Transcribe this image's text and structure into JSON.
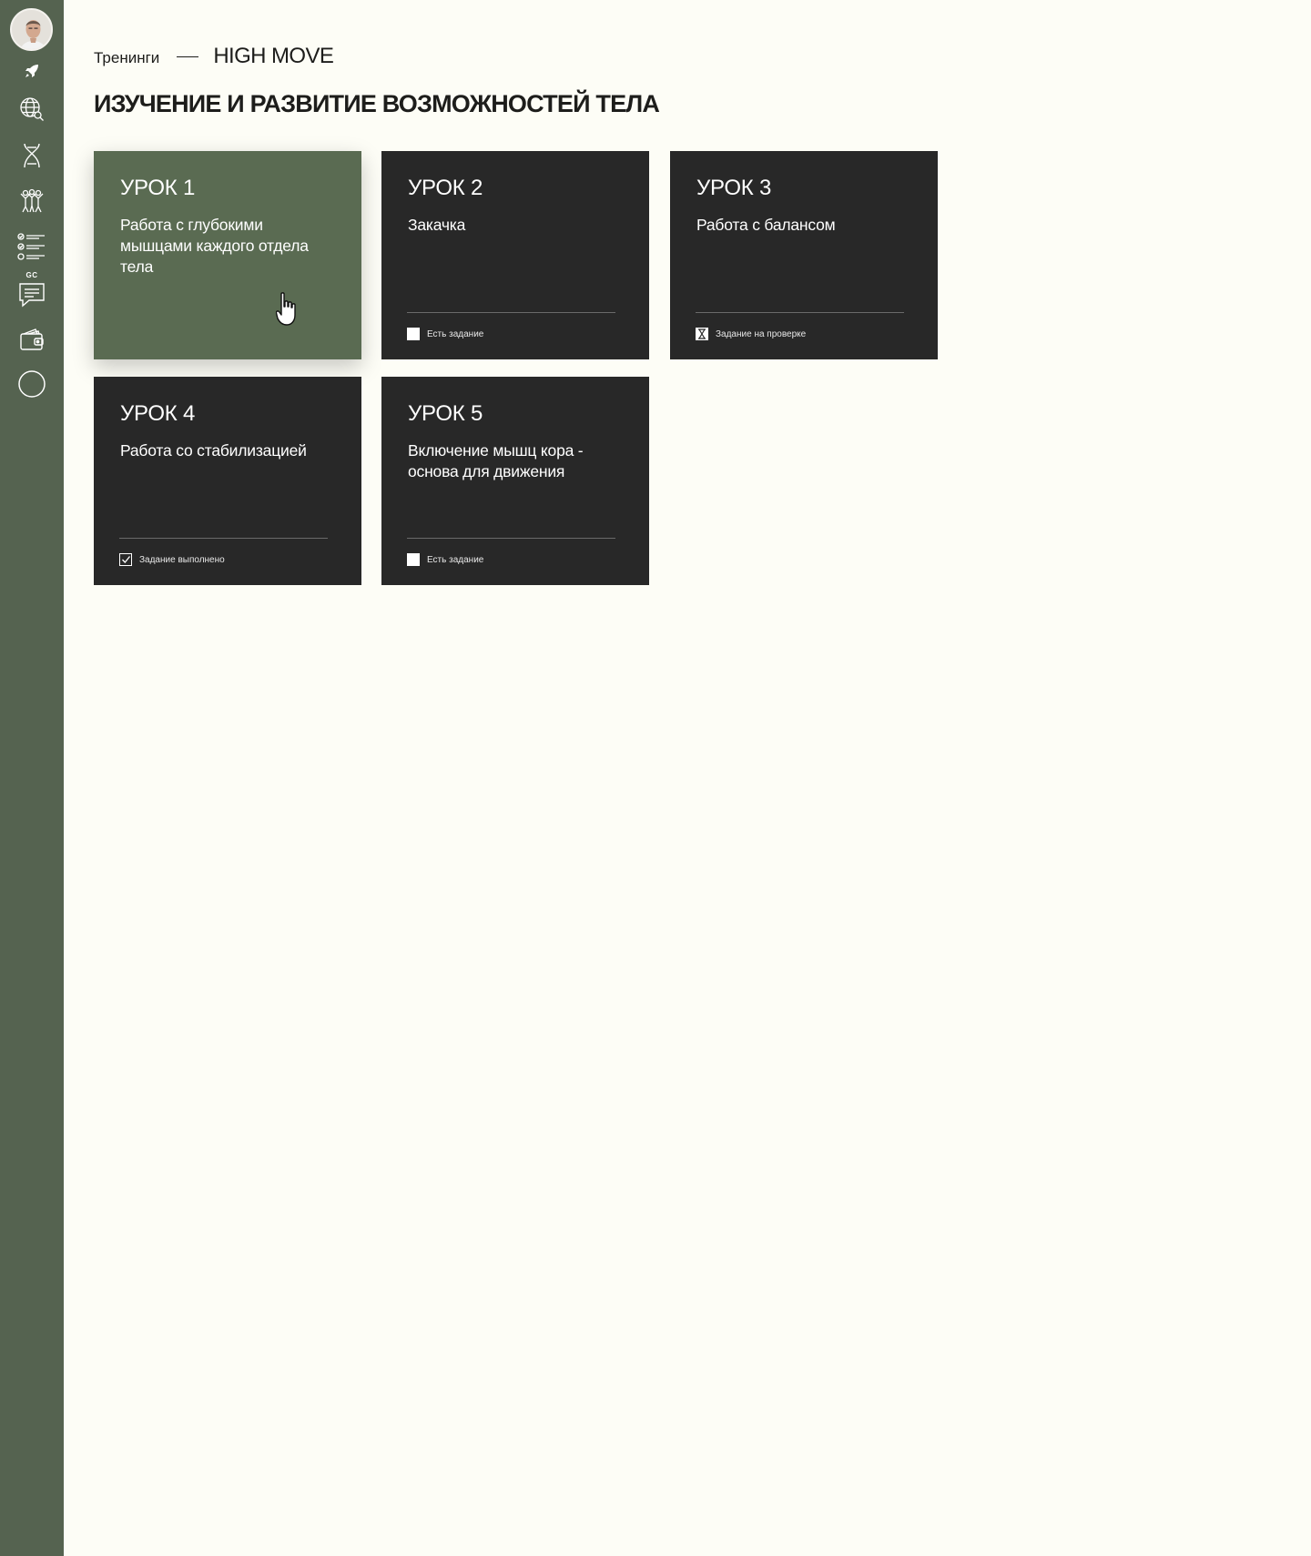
{
  "sidebar": {
    "gc_label": "GC",
    "items": [
      {
        "icon": "avatar"
      },
      {
        "icon": "rocket-icon"
      },
      {
        "icon": "globe-search-icon"
      },
      {
        "icon": "dna-icon"
      },
      {
        "icon": "people-icon"
      },
      {
        "icon": "checklist-icon"
      },
      {
        "icon": "chat-icon"
      },
      {
        "icon": "wallet-icon"
      },
      {
        "icon": "circle-icon"
      }
    ]
  },
  "breadcrumb": {
    "parent": "Тренинги",
    "current": "HIGH MOVE"
  },
  "page_title": "ИЗУЧЕНИЕ И РАЗВИТИЕ ВОЗМОЖНОСТЕЙ ТЕЛА",
  "colors": {
    "sidebar_bg": "#556350",
    "card_bg": "#282828",
    "card_active_bg": "#5a6b52",
    "page_bg": "#fdfdf6"
  },
  "lessons": [
    {
      "title": "УРОК 1",
      "description": "Работа с глубокими мышцами каждого отдела тела",
      "status": "",
      "status_icon": "none"
    },
    {
      "title": "УРОК 2",
      "description": "Закачка",
      "status": "Есть задание",
      "status_icon": "empty-box-icon"
    },
    {
      "title": "УРОК 3",
      "description": "Работа с балансом",
      "status": "Задание на проверке",
      "status_icon": "hourglass-icon"
    },
    {
      "title": "УРОК 4",
      "description": "Работа со стабилизацией",
      "status": "Задание выполнено",
      "status_icon": "checkbox-checked-icon"
    },
    {
      "title": "УРОК 5",
      "description": "Включение мышц кора - основа для движения",
      "status": "Есть задание",
      "status_icon": "empty-box-icon"
    }
  ]
}
